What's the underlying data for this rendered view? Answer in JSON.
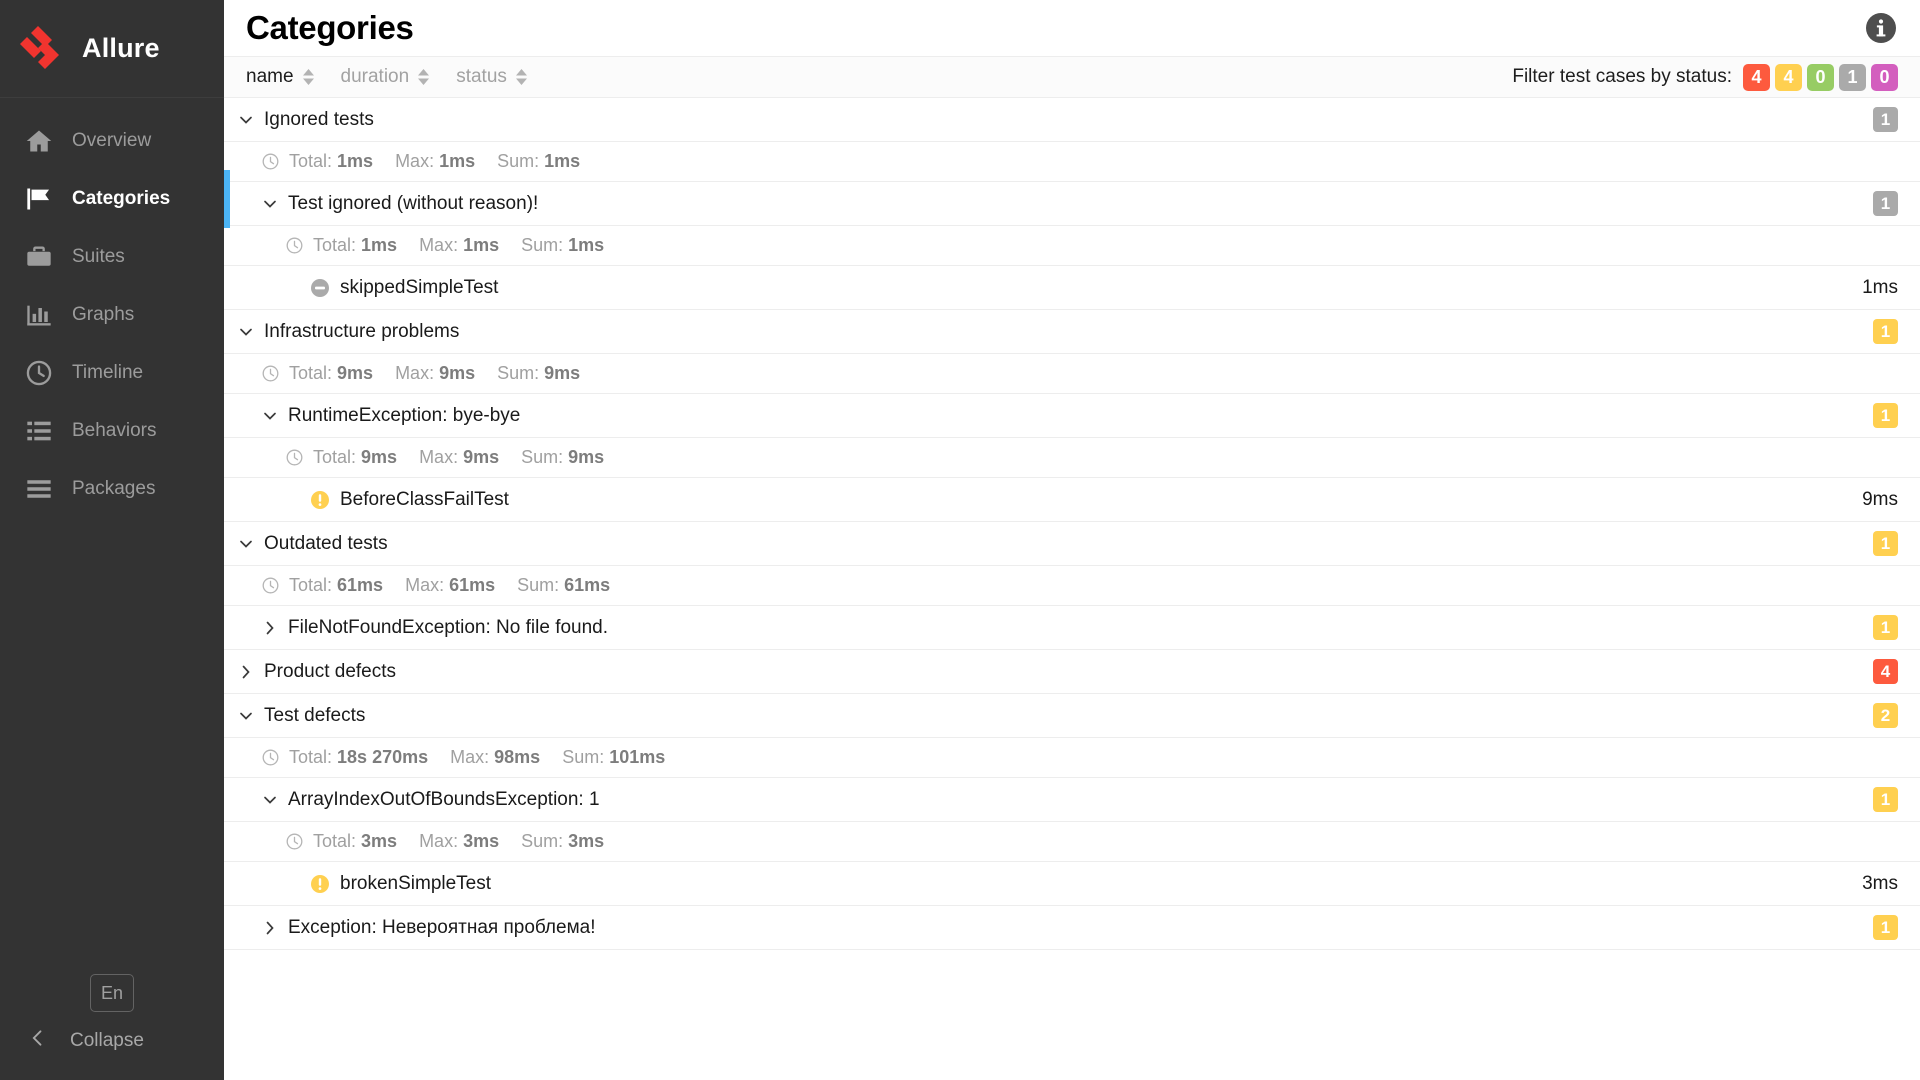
{
  "brand": {
    "name": "Allure",
    "logo_icon": "allure-logo-icon"
  },
  "sidebar": {
    "items": [
      {
        "label": "Overview",
        "icon": "home-icon",
        "active": false
      },
      {
        "label": "Categories",
        "icon": "flag-icon",
        "active": true
      },
      {
        "label": "Suites",
        "icon": "briefcase-icon",
        "active": false
      },
      {
        "label": "Graphs",
        "icon": "bar-chart-icon",
        "active": false
      },
      {
        "label": "Timeline",
        "icon": "clock-icon",
        "active": false
      },
      {
        "label": "Behaviors",
        "icon": "list-icon",
        "active": false
      },
      {
        "label": "Packages",
        "icon": "lines-icon",
        "active": false
      }
    ],
    "language_button": "En",
    "collapse_label": "Collapse",
    "collapse_icon": "chevron-left-icon",
    "active_accent": "#4bb4f5"
  },
  "header": {
    "title": "Categories",
    "info_icon": "info-icon"
  },
  "toolbar": {
    "sorters": [
      {
        "label": "name",
        "active": true
      },
      {
        "label": "duration",
        "active": false
      },
      {
        "label": "status",
        "active": false
      }
    ],
    "filter_label": "Filter test cases by status:",
    "status_filters": [
      {
        "status": "failed",
        "count": "4",
        "color": "#fd5a3e"
      },
      {
        "status": "broken",
        "count": "4",
        "color": "#ffd050"
      },
      {
        "status": "passed",
        "count": "0",
        "color": "#97cc64"
      },
      {
        "status": "skipped",
        "count": "1",
        "color": "#aaaaaa"
      },
      {
        "status": "unknown",
        "count": "0",
        "color": "#d35ebe"
      }
    ]
  },
  "colors": {
    "failed": "#fd5a3e",
    "broken": "#ffd050",
    "passed": "#97cc64",
    "skipped": "#aaaaaa",
    "unknown": "#d35ebe"
  },
  "tree": {
    "stats_labels": {
      "total": "Total:",
      "max": "Max:",
      "sum": "Sum:"
    },
    "nodes": [
      {
        "type": "category",
        "indent": 0,
        "label": "Ignored tests",
        "expanded": true,
        "badge": {
          "count": "1",
          "color": "#aaaaaa"
        }
      },
      {
        "type": "stats",
        "indent": 1,
        "total": "1ms",
        "max": "1ms",
        "sum": "1ms"
      },
      {
        "type": "group",
        "indent": 1,
        "label": "Test ignored (without reason)!",
        "expanded": true,
        "badge": {
          "count": "1",
          "color": "#aaaaaa"
        }
      },
      {
        "type": "stats",
        "indent": 2,
        "total": "1ms",
        "max": "1ms",
        "sum": "1ms"
      },
      {
        "type": "test",
        "indent": 3,
        "label": "skippedSimpleTest",
        "status": "skipped",
        "duration": "1ms"
      },
      {
        "type": "category",
        "indent": 0,
        "label": "Infrastructure problems",
        "expanded": true,
        "badge": {
          "count": "1",
          "color": "#ffd050"
        }
      },
      {
        "type": "stats",
        "indent": 1,
        "total": "9ms",
        "max": "9ms",
        "sum": "9ms"
      },
      {
        "type": "group",
        "indent": 1,
        "label": "RuntimeException: bye-bye",
        "expanded": true,
        "badge": {
          "count": "1",
          "color": "#ffd050"
        }
      },
      {
        "type": "stats",
        "indent": 2,
        "total": "9ms",
        "max": "9ms",
        "sum": "9ms"
      },
      {
        "type": "test",
        "indent": 3,
        "label": "BeforeClassFailTest",
        "status": "broken",
        "duration": "9ms"
      },
      {
        "type": "category",
        "indent": 0,
        "label": "Outdated tests",
        "expanded": true,
        "badge": {
          "count": "1",
          "color": "#ffd050"
        }
      },
      {
        "type": "stats",
        "indent": 1,
        "total": "61ms",
        "max": "61ms",
        "sum": "61ms"
      },
      {
        "type": "group",
        "indent": 1,
        "label": "FileNotFoundException: No file found.",
        "expanded": false,
        "badge": {
          "count": "1",
          "color": "#ffd050"
        }
      },
      {
        "type": "category",
        "indent": 0,
        "label": "Product defects",
        "expanded": false,
        "badge": {
          "count": "4",
          "color": "#fd5a3e"
        }
      },
      {
        "type": "category",
        "indent": 0,
        "label": "Test defects",
        "expanded": true,
        "badge": {
          "count": "2",
          "color": "#ffd050"
        }
      },
      {
        "type": "stats",
        "indent": 1,
        "total": "18s 270ms",
        "max": "98ms",
        "sum": "101ms"
      },
      {
        "type": "group",
        "indent": 1,
        "label": "ArrayIndexOutOfBoundsException: 1",
        "expanded": true,
        "badge": {
          "count": "1",
          "color": "#ffd050"
        }
      },
      {
        "type": "stats",
        "indent": 2,
        "total": "3ms",
        "max": "3ms",
        "sum": "3ms"
      },
      {
        "type": "test",
        "indent": 3,
        "label": "brokenSimpleTest",
        "status": "broken",
        "duration": "3ms"
      },
      {
        "type": "group",
        "indent": 1,
        "label": "Exception: Невероятная проблема!",
        "expanded": false,
        "badge": {
          "count": "1",
          "color": "#ffd050"
        }
      }
    ]
  }
}
